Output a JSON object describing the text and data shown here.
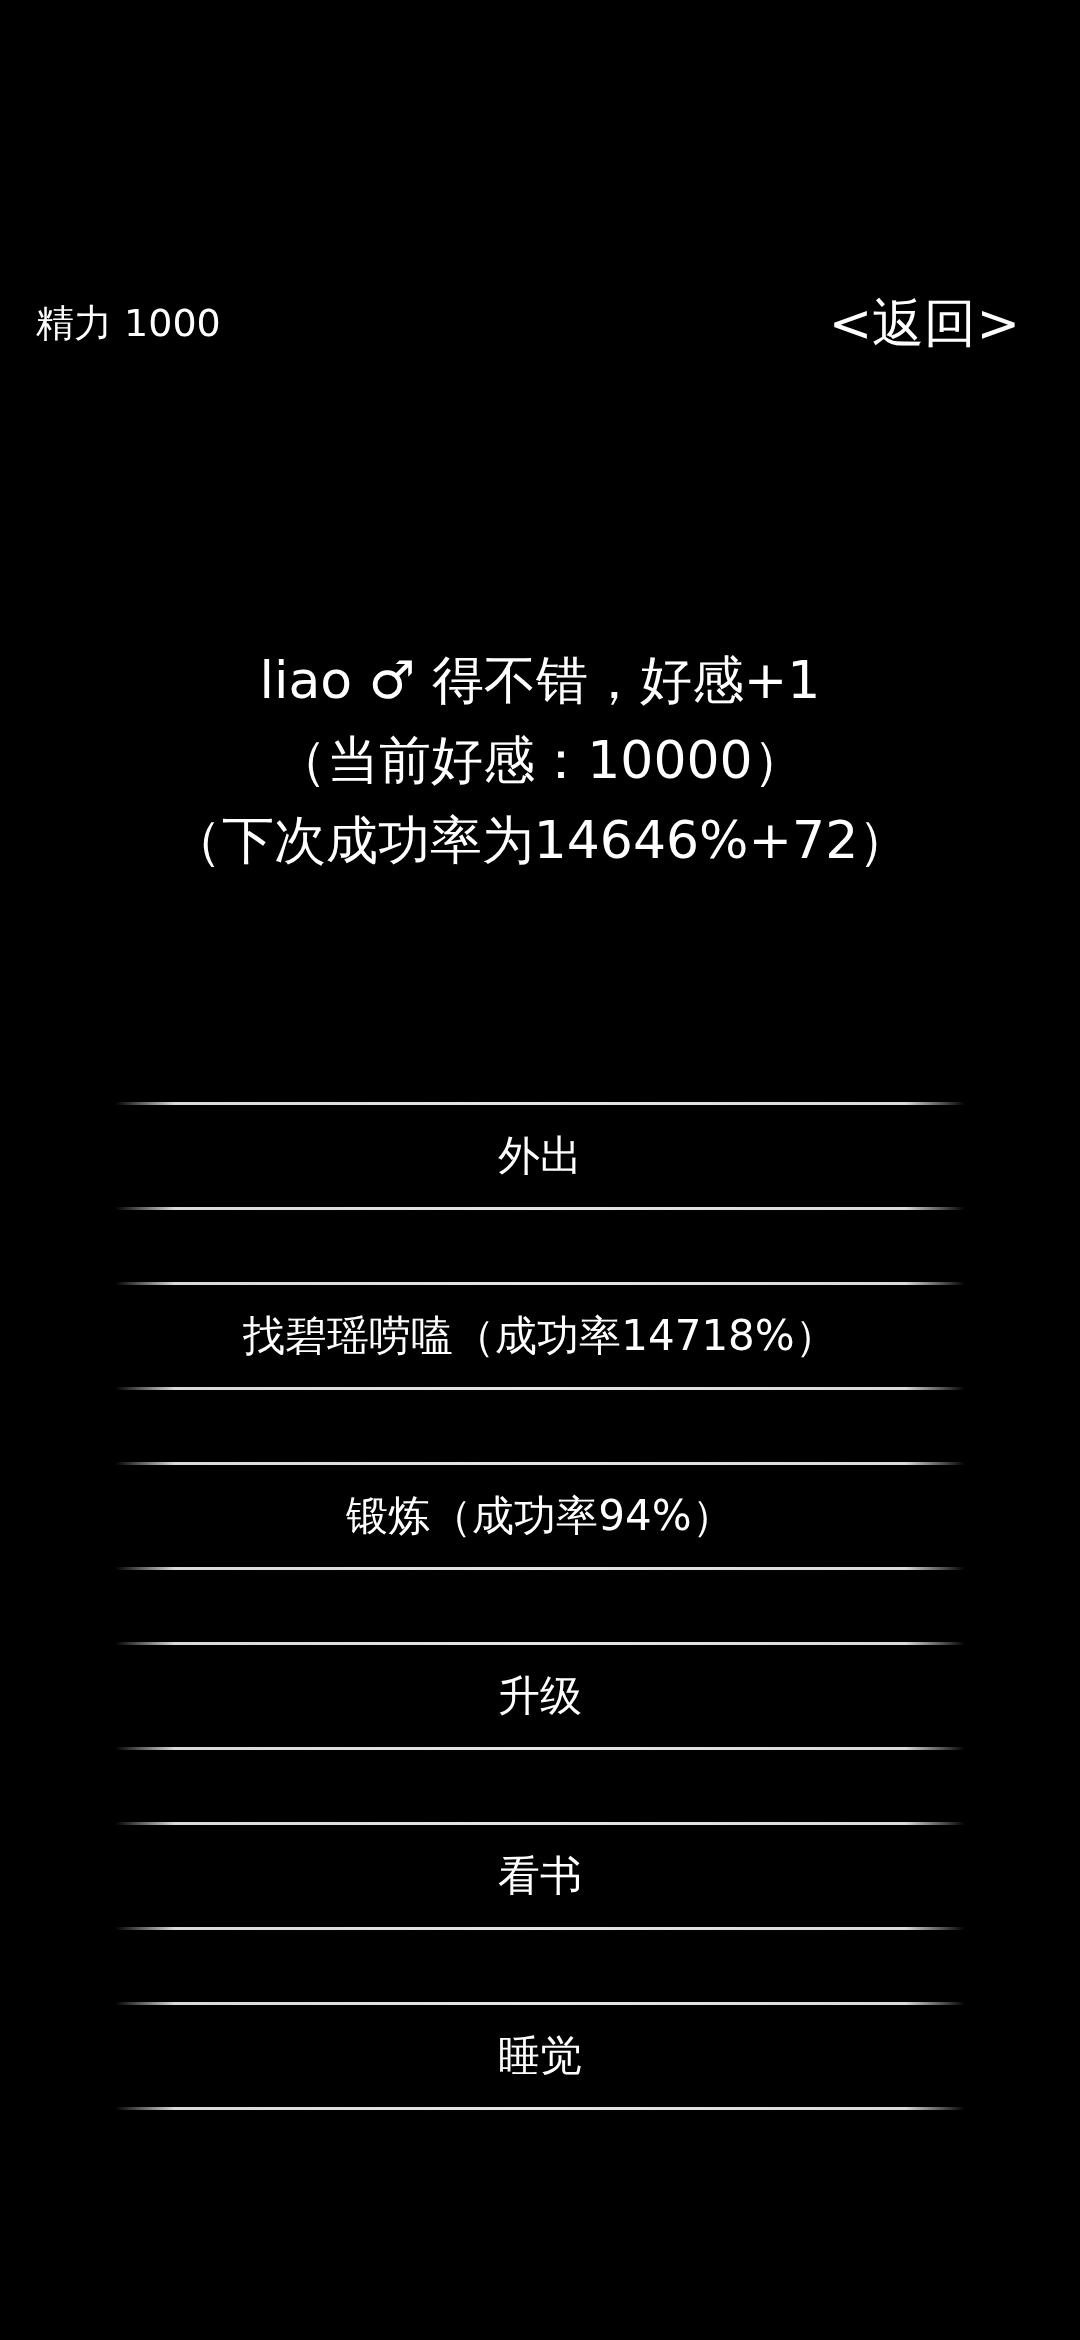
{
  "status": {
    "label": "精力 1000"
  },
  "back_link": {
    "label": "<返回>"
  },
  "message": {
    "lines": [
      "liao ♂ 得不错，好感+1",
      "（当前好感：10000）",
      "（下次成功率为14646%+72）"
    ]
  },
  "actions": [
    {
      "label": "外出"
    },
    {
      "label": "找碧瑶唠嗑（成功率14718%）"
    },
    {
      "label": "锻炼（成功率94%）"
    },
    {
      "label": "升级"
    },
    {
      "label": "看书"
    },
    {
      "label": "睡觉"
    }
  ]
}
